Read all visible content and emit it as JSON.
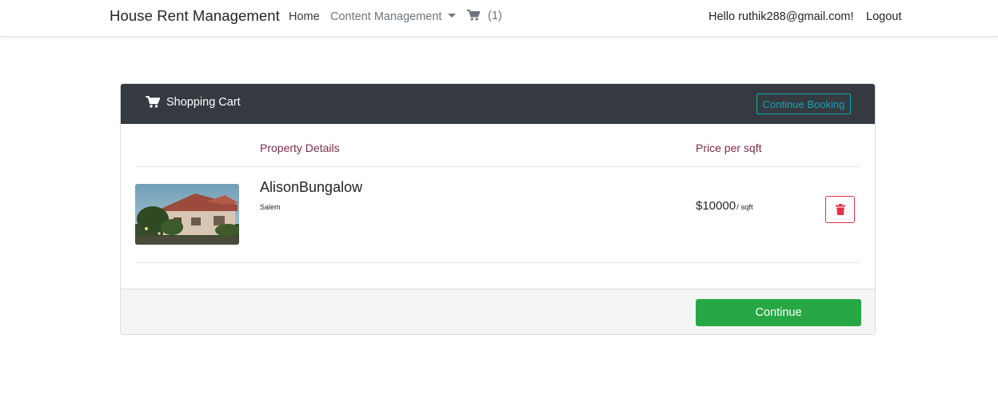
{
  "navbar": {
    "brand": "House Rent Management",
    "home": "Home",
    "content_management": "Content Management",
    "cart_count": "(1)",
    "greeting": "Hello ruthik288@gmail.com!",
    "logout": "Logout",
    "cart_icon": "cart-icon"
  },
  "cart": {
    "title": "Shopping Cart",
    "continue_booking": "Continue Booking",
    "col_property": "Property Details",
    "col_price": "Price per sqft",
    "items": [
      {
        "name": "AlisonBungalow",
        "city": "Salem",
        "price": "$10000",
        "unit": "/ sqft",
        "image": "house-photo",
        "delete_icon": "trash-icon"
      }
    ],
    "continue": "Continue"
  },
  "colors": {
    "header_bg": "#343a40",
    "accent_info": "#17a2b8",
    "danger": "#dc3545",
    "success": "#28a745",
    "column_header": "#7b2e46"
  }
}
